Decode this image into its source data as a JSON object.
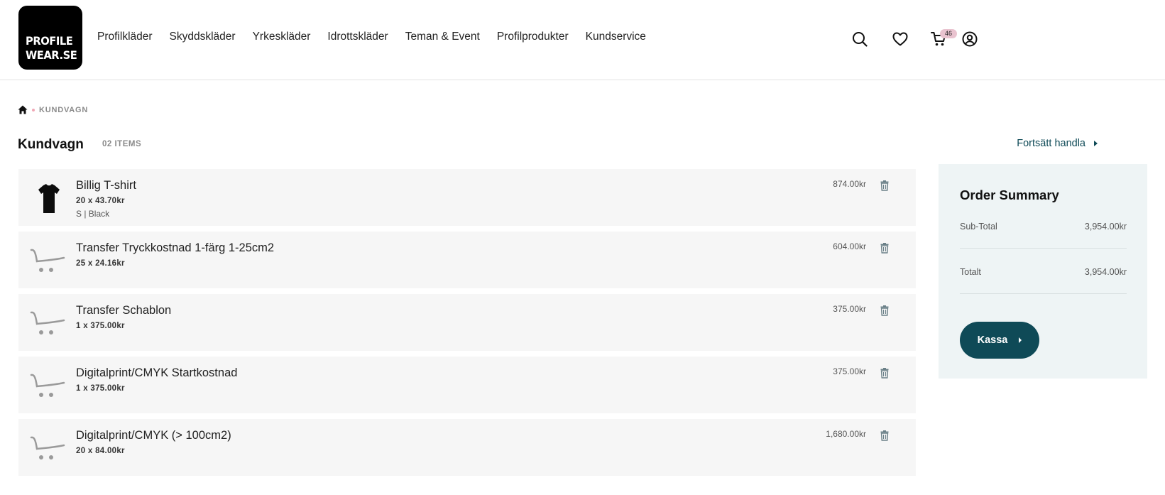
{
  "header": {
    "logo": {
      "line1": "PROFILE",
      "line2": "WEAR.SE"
    },
    "nav": [
      "Profilkläder",
      "Skyddskläder",
      "Yrkeskläder",
      "Idrottskläder",
      "Teman & Event",
      "Profilprodukter",
      "Kundservice"
    ],
    "icons": [
      "search-icon",
      "heart-icon",
      "cart-icon",
      "user-icon"
    ],
    "cart_count": "46"
  },
  "breadcrumb": {
    "current": "KUNDVAGN"
  },
  "page": {
    "title": "Kundvagn",
    "items_count": "02 ITEMS",
    "continue_label": "Fortsätt handla"
  },
  "cart_items": [
    {
      "name": "Billig T-shirt",
      "qty": "20 x 43.70kr",
      "variant": "S | Black",
      "price": "874.00kr",
      "image": "tshirt-icon"
    },
    {
      "name": "Transfer Tryckkostnad 1-färg 1-25cm2",
      "qty": "25 x 24.16kr",
      "variant": "",
      "price": "604.00kr",
      "image": "cart-placeholder-icon"
    },
    {
      "name": "Transfer Schablon",
      "qty": "1 x 375.00kr",
      "variant": "",
      "price": "375.00kr",
      "image": "cart-placeholder-icon"
    },
    {
      "name": "Digitalprint/CMYK Startkostnad",
      "qty": "1 x 375.00kr",
      "variant": "",
      "price": "375.00kr",
      "image": "cart-placeholder-icon"
    },
    {
      "name": "Digitalprint/CMYK (> 100cm2)",
      "qty": "20 x 84.00kr",
      "variant": "",
      "price": "1,680.00kr",
      "image": "cart-placeholder-icon"
    }
  ],
  "summary": {
    "title": "Order Summary",
    "subtotal_label": "Sub-Total",
    "subtotal_value": "3,954.00kr",
    "total_label": "Totalt",
    "total_value": "3,954.00kr",
    "checkout_label": "Kassa"
  },
  "colors": {
    "accent": "#0f4a57",
    "summary_bg": "#eef4f5",
    "row_bg": "#f6f6f6",
    "badge": "#e9c3cf"
  }
}
